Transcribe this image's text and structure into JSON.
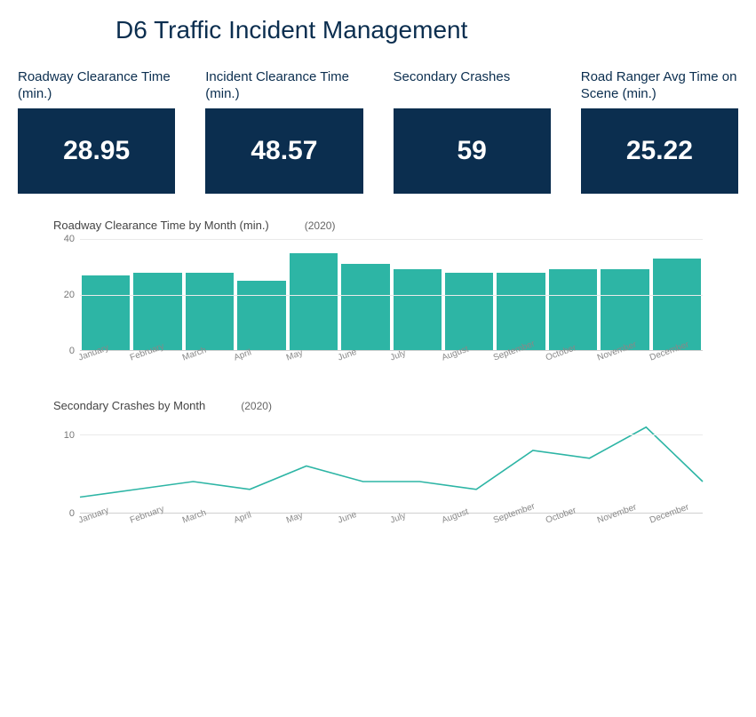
{
  "title": "D6 Traffic Incident Management",
  "kpis": [
    {
      "label": "Roadway Clearance Time (min.)",
      "value": "28.95"
    },
    {
      "label": "Incident Clearance Time (min.)",
      "value": "48.57"
    },
    {
      "label": "Secondary Crashes",
      "value": "59"
    },
    {
      "label": "Road Ranger Avg Time on Scene (min.)",
      "value": "25.22"
    }
  ],
  "charts": {
    "bar": {
      "title": "Roadway Clearance Time by Month (min.)",
      "year": "(2020)"
    },
    "line": {
      "title": "Secondary Crashes by Month",
      "year": "(2020)"
    }
  },
  "chart_data": [
    {
      "type": "bar",
      "title": "Roadway Clearance Time by Month (min.)",
      "year": 2020,
      "categories": [
        "January",
        "February",
        "March",
        "April",
        "May",
        "June",
        "July",
        "August",
        "September",
        "October",
        "November",
        "December"
      ],
      "values": [
        27,
        28,
        28,
        25,
        35,
        31,
        29,
        28,
        28,
        29,
        29,
        33
      ],
      "ylim": [
        0,
        40
      ],
      "yticks": [
        0,
        20,
        40
      ],
      "xlabel": "",
      "ylabel": ""
    },
    {
      "type": "line",
      "title": "Secondary Crashes by Month",
      "year": 2020,
      "categories": [
        "January",
        "February",
        "March",
        "April",
        "May",
        "June",
        "July",
        "August",
        "September",
        "October",
        "November",
        "December"
      ],
      "values": [
        2,
        3,
        4,
        3,
        6,
        4,
        4,
        3,
        8,
        7,
        11,
        4
      ],
      "ylim": [
        0,
        12
      ],
      "yticks": [
        0,
        10
      ],
      "xlabel": "",
      "ylabel": ""
    }
  ]
}
